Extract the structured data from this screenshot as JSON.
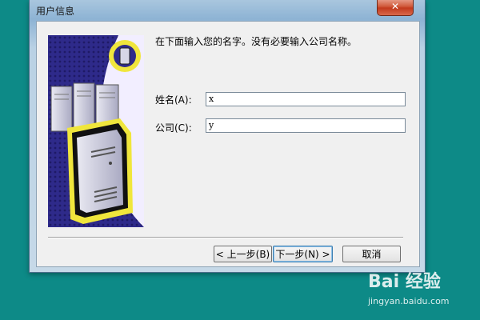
{
  "window": {
    "title": "用户信息",
    "close_label": "✕"
  },
  "prompt": "在下面输入您的名字。没有必要输入公司名称。",
  "form": {
    "name_label": "姓名(A):",
    "name_value": "x",
    "company_label": "公司(C):",
    "company_value": "y"
  },
  "buttons": {
    "back": "< 上一步(B)",
    "next": "下一步(N) >",
    "cancel": "取消"
  },
  "watermark": {
    "logo": "Bai 经验",
    "url": "jingyan.baidu.com"
  },
  "colors": {
    "desktop": "#0d8a87",
    "illustration_bg": "#2e2a8a",
    "server_glow": "#f0e63c"
  }
}
